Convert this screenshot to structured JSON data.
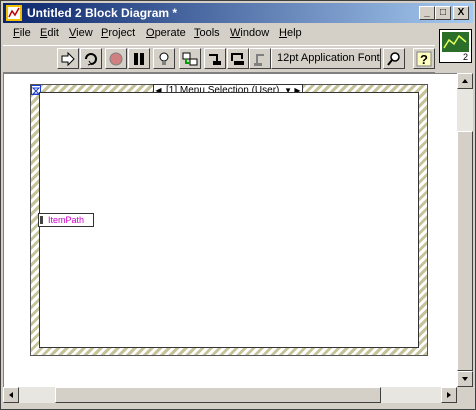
{
  "window": {
    "title": "Untitled 2 Block Diagram *",
    "buttons": {
      "minimize": "_",
      "maximize": "□",
      "close": "X"
    }
  },
  "menu": [
    {
      "pre": "",
      "u": "F",
      "post": "ile"
    },
    {
      "pre": "",
      "u": "E",
      "post": "dit"
    },
    {
      "pre": "",
      "u": "V",
      "post": "iew"
    },
    {
      "pre": "",
      "u": "P",
      "post": "roject"
    },
    {
      "pre": "",
      "u": "O",
      "post": "perate"
    },
    {
      "pre": "",
      "u": "T",
      "post": "ools"
    },
    {
      "pre": "",
      "u": "W",
      "post": "indow"
    },
    {
      "pre": "",
      "u": "H",
      "post": "elp"
    }
  ],
  "toolbar": {
    "font": "12pt Application Font",
    "tools": [
      "run-arrow-icon",
      "run-continuous-icon",
      "abort-icon",
      "pause-icon",
      "highlight-execution-icon",
      "retain-wire-values-icon",
      "step-into-icon",
      "step-over-icon",
      "step-out-icon",
      "font-search-icon",
      "context-help-icon"
    ]
  },
  "vi_icon": {
    "number": "2"
  },
  "diagram": {
    "event_structure": {
      "case_label": "[1] Menu Selection (User)"
    },
    "node": {
      "label": "ItemPath"
    }
  },
  "colors": {
    "accent": "#0a246a",
    "label": "#cc00cc",
    "hatch": "#c6c39a"
  }
}
